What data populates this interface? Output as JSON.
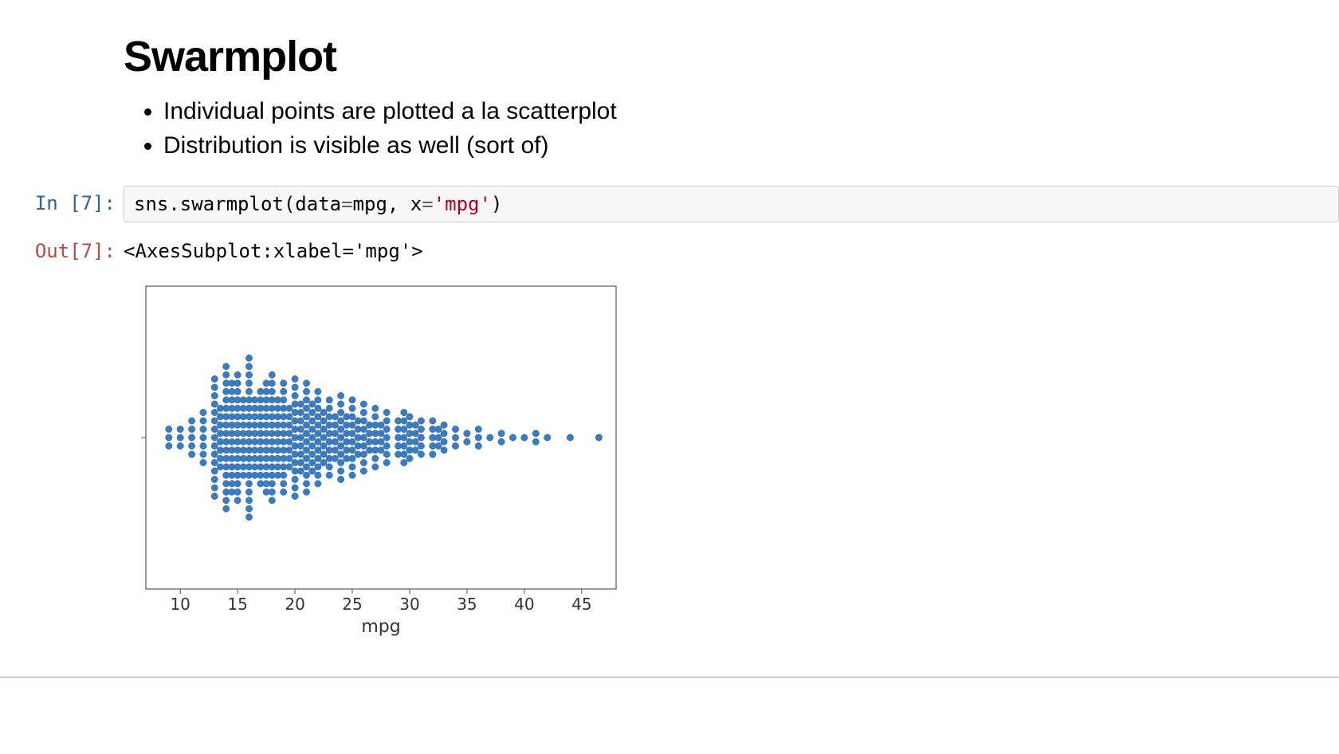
{
  "markdown": {
    "title": "Swarmplot",
    "bullets": [
      "Individual points are plotted a la scatterplot",
      "Distribution is visible as well (sort of)"
    ]
  },
  "code_cell": {
    "in_prompt": "In [7]:",
    "out_prompt": "Out[7]:",
    "code_tokens": [
      {
        "t": "sns.swarmplot",
        "cls": "fn"
      },
      {
        "t": "(",
        "cls": "paren"
      },
      {
        "t": "data",
        "cls": "arg"
      },
      {
        "t": "=",
        "cls": "op"
      },
      {
        "t": "mpg, x",
        "cls": "arg"
      },
      {
        "t": "=",
        "cls": "op"
      },
      {
        "t": "'mpg'",
        "cls": "str"
      },
      {
        "t": ")",
        "cls": "paren"
      }
    ],
    "out_text": "<AxesSubplot:xlabel='mpg'>"
  },
  "chart_data": {
    "type": "swarm",
    "xlabel": "mpg",
    "ylabel": "",
    "xlim": [
      7,
      48
    ],
    "ticks": [
      10,
      15,
      20,
      25,
      30,
      35,
      40,
      45
    ],
    "dot_color": "#3b7bbf",
    "columns": [
      {
        "x": 9,
        "n": 3
      },
      {
        "x": 10,
        "n": 3
      },
      {
        "x": 11,
        "n": 5
      },
      {
        "x": 12,
        "n": 7
      },
      {
        "x": 13,
        "n": 15
      },
      {
        "x": 13.5,
        "n": 8
      },
      {
        "x": 14,
        "n": 18
      },
      {
        "x": 14.5,
        "n": 14
      },
      {
        "x": 15,
        "n": 16
      },
      {
        "x": 15.5,
        "n": 10
      },
      {
        "x": 16,
        "n": 20
      },
      {
        "x": 16.5,
        "n": 10
      },
      {
        "x": 17,
        "n": 12
      },
      {
        "x": 17.5,
        "n": 14
      },
      {
        "x": 18,
        "n": 16
      },
      {
        "x": 18.5,
        "n": 10
      },
      {
        "x": 19,
        "n": 14
      },
      {
        "x": 19.5,
        "n": 8
      },
      {
        "x": 20,
        "n": 15
      },
      {
        "x": 20.5,
        "n": 9
      },
      {
        "x": 21,
        "n": 14
      },
      {
        "x": 21.5,
        "n": 9
      },
      {
        "x": 22,
        "n": 12
      },
      {
        "x": 22.5,
        "n": 7
      },
      {
        "x": 23,
        "n": 10
      },
      {
        "x": 23.5,
        "n": 6
      },
      {
        "x": 24,
        "n": 11
      },
      {
        "x": 24.5,
        "n": 6
      },
      {
        "x": 25,
        "n": 10
      },
      {
        "x": 25.5,
        "n": 5
      },
      {
        "x": 26,
        "n": 9
      },
      {
        "x": 26.5,
        "n": 4
      },
      {
        "x": 27,
        "n": 8
      },
      {
        "x": 27.5,
        "n": 4
      },
      {
        "x": 28,
        "n": 7
      },
      {
        "x": 29,
        "n": 5
      },
      {
        "x": 29.5,
        "n": 7
      },
      {
        "x": 30,
        "n": 6
      },
      {
        "x": 30.5,
        "n": 4
      },
      {
        "x": 31,
        "n": 5
      },
      {
        "x": 32,
        "n": 5
      },
      {
        "x": 32.5,
        "n": 3
      },
      {
        "x": 33,
        "n": 4
      },
      {
        "x": 34,
        "n": 3
      },
      {
        "x": 35,
        "n": 2
      },
      {
        "x": 36,
        "n": 3
      },
      {
        "x": 37,
        "n": 1
      },
      {
        "x": 38,
        "n": 2
      },
      {
        "x": 39,
        "n": 1
      },
      {
        "x": 40,
        "n": 1
      },
      {
        "x": 41,
        "n": 2
      },
      {
        "x": 42,
        "n": 1
      },
      {
        "x": 44,
        "n": 1
      },
      {
        "x": 46.5,
        "n": 1
      }
    ]
  }
}
